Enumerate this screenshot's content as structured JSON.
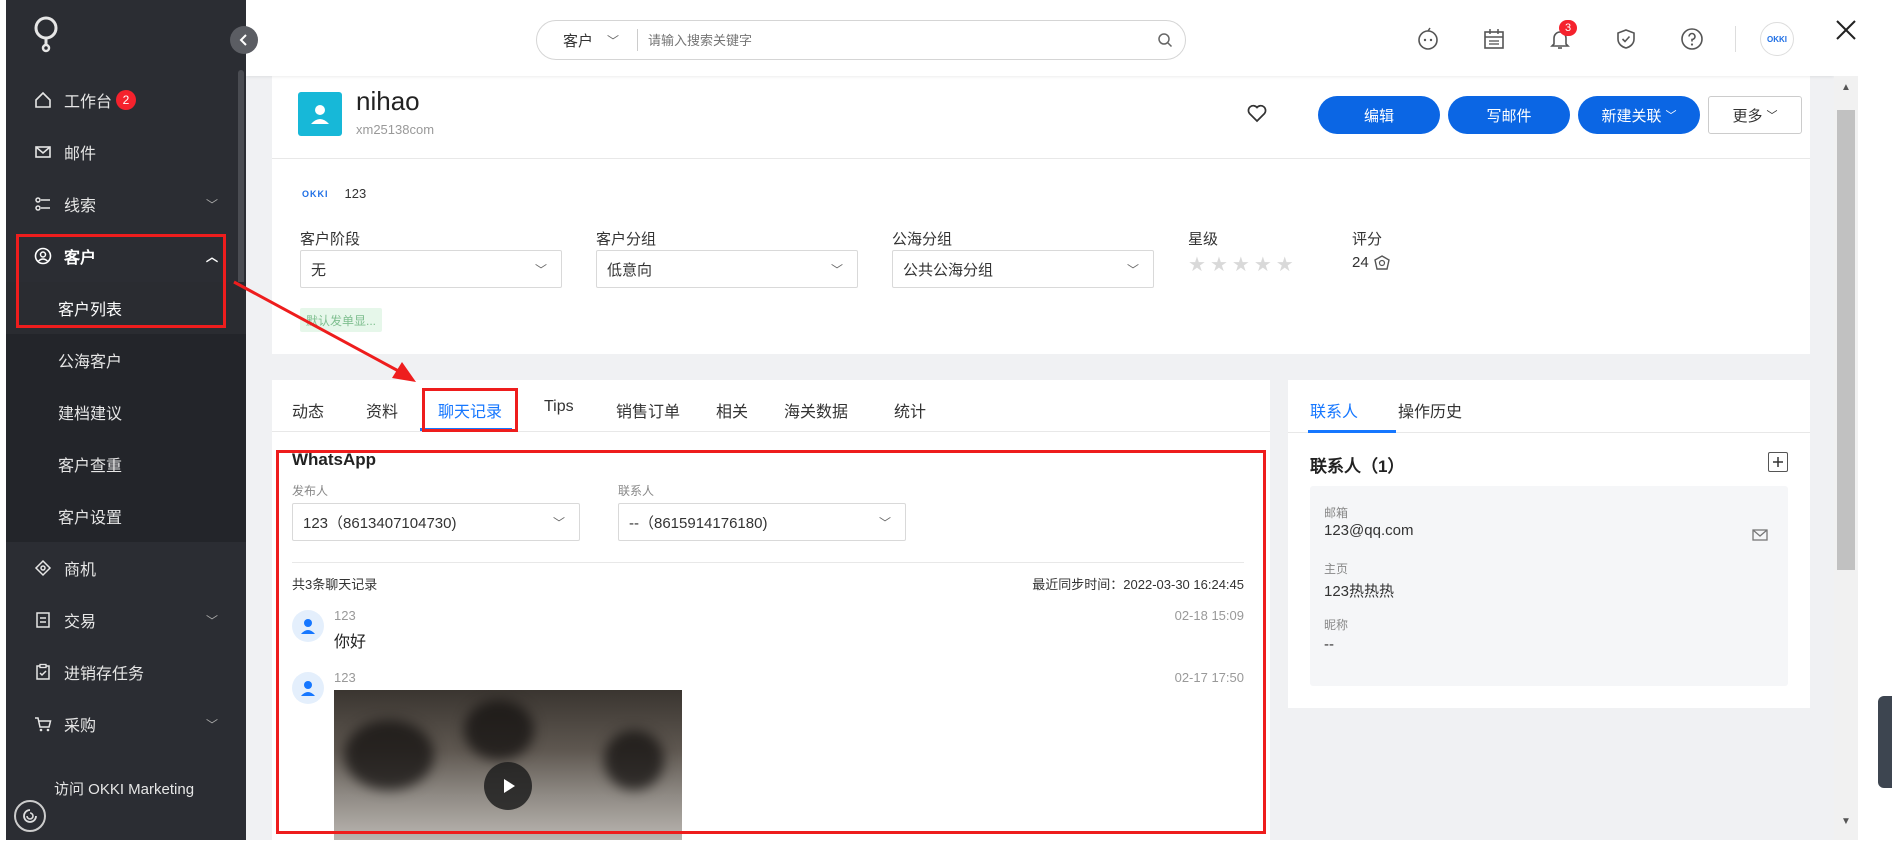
{
  "sidebar": {
    "items": [
      {
        "label": "工作台",
        "badge": "2"
      },
      {
        "label": "邮件"
      },
      {
        "label": "线索"
      },
      {
        "label": "客户"
      },
      {
        "label": "客户列表"
      },
      {
        "label": "公海客户"
      },
      {
        "label": "建档建议"
      },
      {
        "label": "客户查重"
      },
      {
        "label": "客户设置"
      },
      {
        "label": "商机"
      },
      {
        "label": "交易"
      },
      {
        "label": "进销存任务"
      },
      {
        "label": "采购"
      }
    ],
    "marketing_link": "访问 OKKI Marketing"
  },
  "topbar": {
    "search_scope": "客户",
    "search_placeholder": "请输入搜索关键字",
    "notification_count": "3",
    "avatar_text": "OKKI"
  },
  "customer": {
    "name": "nihao",
    "sub": "xm25138com",
    "buttons": {
      "edit": "编辑",
      "email": "写邮件",
      "new_link": "新建关联",
      "more": "更多"
    },
    "okki_label": "OKKI",
    "okki_value": "123",
    "fields": {
      "stage_label": "客户阶段",
      "stage_value": "无",
      "group_label": "客户分组",
      "group_value": "低意向",
      "pool_label": "公海分组",
      "pool_value": "公共公海分组",
      "star_label": "星级",
      "score_label": "评分",
      "score_value": "24"
    },
    "tag": "默认发单显..."
  },
  "tabs": [
    "动态",
    "资料",
    "聊天记录",
    "Tips",
    "销售订单",
    "相关",
    "海关数据",
    "统计"
  ],
  "chat": {
    "title": "WhatsApp",
    "publisher_label": "发布人",
    "publisher_value": "123（8613407104730)",
    "contact_label": "联系人",
    "contact_value": "--（8615914176180)",
    "count_text": "共3条聊天记录",
    "sync_text": "最近同步时间：2022-03-30 16:24:45",
    "messages": [
      {
        "sender": "123",
        "text": "你好",
        "time": "02-18 15:09"
      },
      {
        "sender": "123",
        "time": "02-17 17:50"
      }
    ]
  },
  "right": {
    "tabs": [
      "联系人",
      "操作历史"
    ],
    "title": "联系人（1）",
    "email_label": "邮箱",
    "email_value": "123@qq.com",
    "homepage_label": "主页",
    "homepage_value": "123热热热",
    "nickname_label": "昵称",
    "nickname_value": "--"
  },
  "colors": {
    "primary": "#0b66e4",
    "sidebar": "#2b2d33",
    "annotation": "#ee1d1d",
    "avatar": "#17b8d8"
  }
}
